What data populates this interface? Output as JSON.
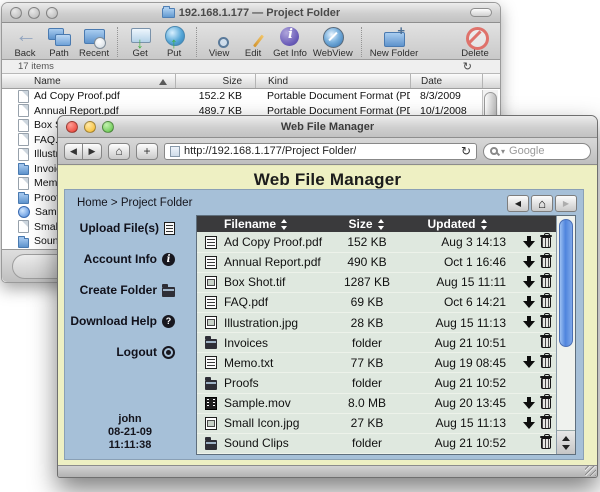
{
  "colors": {
    "page_bg": "#eef0c3",
    "panel_bg": "#a6c0d8",
    "table_row_bg": "#dfe8df",
    "table_header_bg": "#3a3a3c",
    "scroll_thumb": "#4f84dd"
  },
  "finder": {
    "title": "192.168.1.177 — Project Folder",
    "items_count": "17 items",
    "toolbar": [
      {
        "label": "Back",
        "icon": "back"
      },
      {
        "label": "Path",
        "icon": "path"
      },
      {
        "label": "Recent",
        "icon": "recent"
      },
      {
        "label": "",
        "icon": "separator"
      },
      {
        "label": "Get",
        "icon": "get"
      },
      {
        "label": "Put",
        "icon": "put"
      },
      {
        "label": "",
        "icon": "separator"
      },
      {
        "label": "View",
        "icon": "view"
      },
      {
        "label": "Edit",
        "icon": "edit"
      },
      {
        "label": "Get Info",
        "icon": "getinfo"
      },
      {
        "label": "WebView",
        "icon": "webview"
      },
      {
        "label": "",
        "icon": "separator"
      },
      {
        "label": "New Folder",
        "icon": "newfolder"
      },
      {
        "label": "Delete",
        "icon": "delete"
      }
    ],
    "columns": [
      "Name",
      "Size",
      "Kind",
      "Date"
    ],
    "rows": [
      {
        "name": "Ad Copy Proof.pdf",
        "size": "152.2 KB",
        "kind": "Portable Document Format (PDF)",
        "date": "8/3/2009",
        "icon": "document"
      },
      {
        "name": "Annual Report.pdf",
        "size": "489.7 KB",
        "kind": "Portable Document Format (PDF)",
        "date": "10/1/2008",
        "icon": "document"
      },
      {
        "name": "Box Shot.tif",
        "icon": "document"
      },
      {
        "name": "FAQ.pdf",
        "icon": "document"
      },
      {
        "name": "Illustration.jpg",
        "icon": "document"
      },
      {
        "name": "Invoices",
        "icon": "folder"
      },
      {
        "name": "Memo.txt",
        "icon": "document"
      },
      {
        "name": "Proofs",
        "icon": "folder"
      },
      {
        "name": "Sample.mov",
        "icon": "qt"
      },
      {
        "name": "Small Icon.jpg",
        "icon": "document"
      },
      {
        "name": "Sound Clips",
        "icon": "folder"
      }
    ]
  },
  "web": {
    "title": "Web File Manager",
    "url": "http://192.168.1.177/Project Folder/",
    "search_placeholder": "Google",
    "heading": "Web File Manager",
    "breadcrumb": {
      "home": "Home",
      "sep": ">",
      "current": "Project Folder"
    },
    "sidebar": [
      {
        "label": "Upload File(s)",
        "icon": "doc"
      },
      {
        "label": "Account Info",
        "icon": "info"
      },
      {
        "label": "Create Folder",
        "icon": "folder"
      },
      {
        "label": "Download Help",
        "icon": "help"
      },
      {
        "label": "Logout",
        "icon": "logout"
      }
    ],
    "table": {
      "headers": [
        "Filename",
        "Size",
        "Updated"
      ],
      "rows": [
        {
          "name": "Ad Copy Proof.pdf",
          "size": "152 KB",
          "updated": "Aug 3 14:13",
          "icon": "doc",
          "downloadable": true
        },
        {
          "name": "Annual Report.pdf",
          "size": "490 KB",
          "updated": "Oct 1 16:46",
          "icon": "doc",
          "downloadable": true
        },
        {
          "name": "Box Shot.tif",
          "size": "1287 KB",
          "updated": "Aug 15 11:11",
          "icon": "img",
          "downloadable": true
        },
        {
          "name": "FAQ.pdf",
          "size": "69 KB",
          "updated": "Oct 6 14:21",
          "icon": "doc",
          "downloadable": true
        },
        {
          "name": "Illustration.jpg",
          "size": "28 KB",
          "updated": "Aug 15 11:13",
          "icon": "img",
          "downloadable": true
        },
        {
          "name": "Invoices",
          "size": "folder",
          "updated": "Aug 21 10:51",
          "icon": "folder",
          "downloadable": false
        },
        {
          "name": "Memo.txt",
          "size": "77 KB",
          "updated": "Aug 19 08:45",
          "icon": "doc",
          "downloadable": true
        },
        {
          "name": "Proofs",
          "size": "folder",
          "updated": "Aug 21 10:52",
          "icon": "folder",
          "downloadable": false
        },
        {
          "name": "Sample.mov",
          "size": "8.0 MB",
          "updated": "Aug 20 13:45",
          "icon": "movie",
          "downloadable": true
        },
        {
          "name": "Small Icon.jpg",
          "size": "27 KB",
          "updated": "Aug 15 11:13",
          "icon": "img",
          "downloadable": true
        },
        {
          "name": "Sound Clips",
          "size": "folder",
          "updated": "Aug 21 10:52",
          "icon": "folder",
          "downloadable": false
        }
      ]
    },
    "user": {
      "name": "john",
      "date": "08-21-09",
      "time": "11:11:38"
    }
  }
}
